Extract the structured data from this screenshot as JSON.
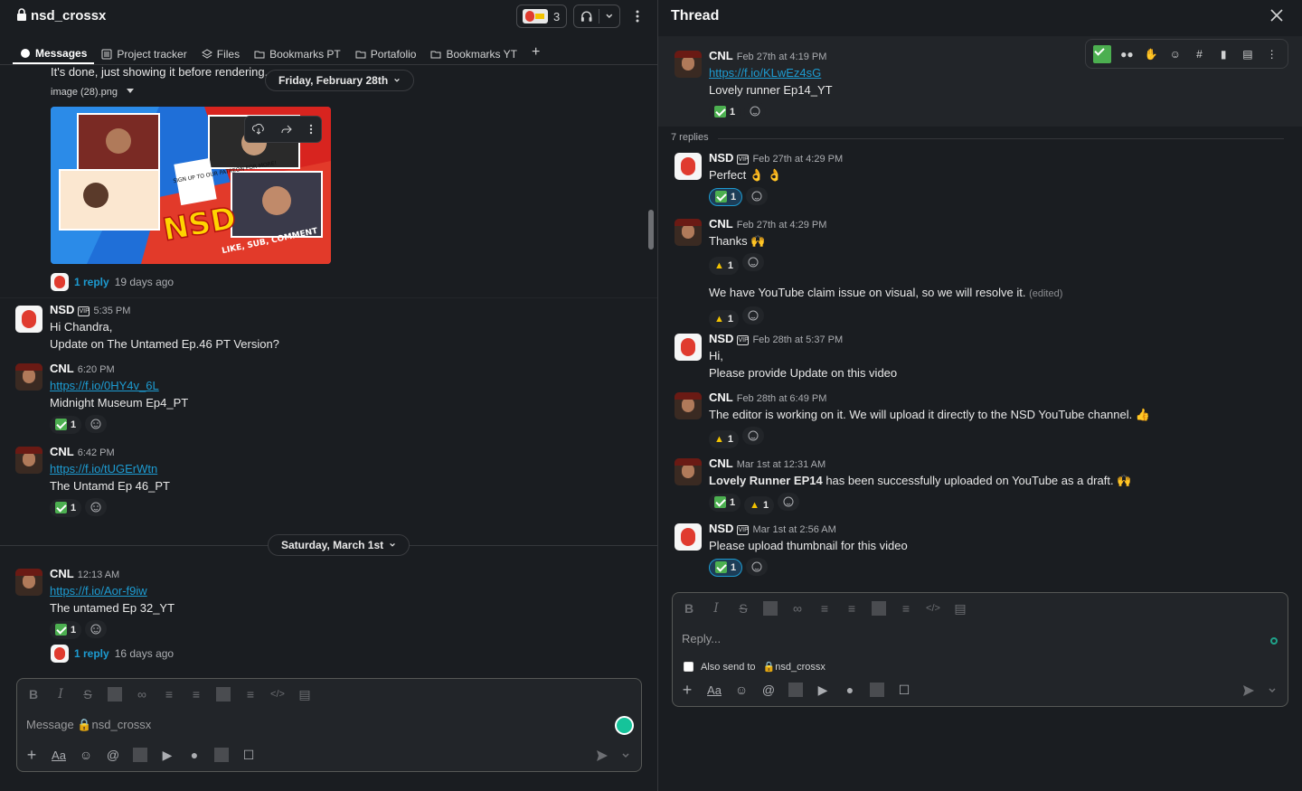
{
  "channel": {
    "name": "nsd_crossx",
    "members_count": "3",
    "tabs": [
      {
        "label": "Messages",
        "icon": "message-icon"
      },
      {
        "label": "Project tracker",
        "icon": "list-icon"
      },
      {
        "label": "Files",
        "icon": "files-icon"
      },
      {
        "label": "Bookmarks PT",
        "icon": "folder-icon"
      },
      {
        "label": "Portafolio",
        "icon": "folder-icon"
      },
      {
        "label": "Bookmarks YT",
        "icon": "folder-icon"
      }
    ],
    "add_tab": "+"
  },
  "feed": {
    "top_line": "It's done, just showing it before rendering.",
    "date1": "Friday, February 28th",
    "attachment_name": "image (28).png",
    "thumb_text": {
      "brand": "NSD",
      "signup": "SIGN UP TO OUR PATREON FOR MORE!",
      "like": "LIKE, SUB, COMMENT"
    },
    "reply1": {
      "count": "1 reply",
      "ago": "19 days ago"
    },
    "msg_nsd": {
      "user": "NSD",
      "time": "5:35 PM",
      "line1": "Hi Chandra,",
      "line2": "Update on The Untamed Ep.46 PT Version?"
    },
    "msg_cnl1": {
      "user": "CNL",
      "time": "6:20 PM",
      "link": "https://f.io/0HY4v_6L",
      "text": "Midnight Museum Ep4_PT",
      "react_count": "1"
    },
    "msg_cnl2": {
      "user": "CNL",
      "time": "6:42 PM",
      "link": "https://f.io/tUGErWtn",
      "text": "The Untamd Ep 46_PT",
      "react_count": "1"
    },
    "date2": "Saturday, March 1st",
    "msg_cnl3": {
      "user": "CNL",
      "time": "12:13 AM",
      "link": "https://f.io/Aor-f9iw",
      "text": "The untamed Ep 32_YT",
      "react_count": "1"
    },
    "reply2": {
      "count": "1 reply",
      "ago": "16 days ago"
    }
  },
  "composer": {
    "placeholder": "Message 🔒nsd_crossx"
  },
  "thread": {
    "title": "Thread",
    "parent": {
      "user": "CNL",
      "time": "Feb 27th at 4:19 PM",
      "link": "https://f.io/KLwEz4sG",
      "text": "Lovely runner Ep14_YT",
      "react_count": "1"
    },
    "replies_label": "7 replies",
    "replies": [
      {
        "user": "NSD",
        "time": "Feb 27th at 4:29 PM",
        "text": "Perfect 👌 👌",
        "react_count": "1"
      },
      {
        "user": "CNL",
        "time": "Feb 27th at 4:29 PM",
        "text": "Thanks 🙌",
        "react_count": "1",
        "text2": "We have YouTube claim issue on visual, so we will resolve it.",
        "edited": "(edited)",
        "react2_count": "1"
      },
      {
        "user": "NSD",
        "time": "Feb 28th at 5:37 PM",
        "line1": "Hi,",
        "line2": "Please provide Update on this video"
      },
      {
        "user": "CNL",
        "time": "Feb 28th at 6:49 PM",
        "text": "The editor is working on it. We will upload it directly to the NSD YouTube channel. 👍",
        "react_count": "1"
      },
      {
        "user": "CNL",
        "time": "Mar 1st at 12:31 AM",
        "bold": "Lovely Runner EP14",
        "text": " has been successfully uploaded on YouTube as a draft. 🙌",
        "react_count": "1",
        "react2_count": "1"
      },
      {
        "user": "NSD",
        "time": "Mar 1st at 2:56 AM",
        "text": "Please upload thumbnail for this video",
        "react_count": "1"
      }
    ],
    "reply_placeholder": "Reply...",
    "also_send_label": "Also send to",
    "also_send_channel": "nsd_crossx"
  },
  "colors": {
    "background": "#1a1d21",
    "link": "#1d9bd1",
    "accent_check": "#4caf50"
  }
}
